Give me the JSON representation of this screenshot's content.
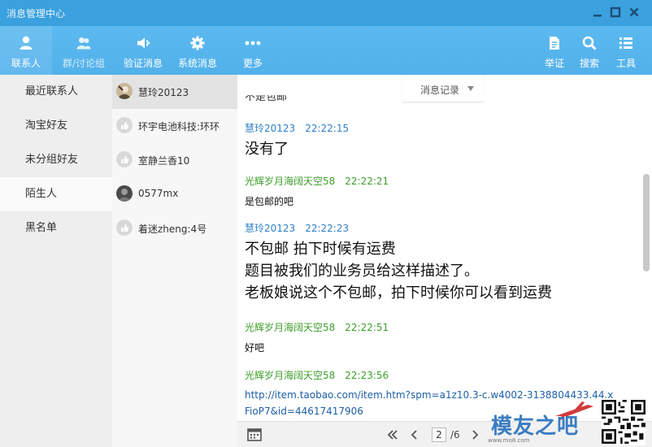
{
  "window": {
    "title": "消息管理中心"
  },
  "toolbar": {
    "left": [
      {
        "label": "联系人",
        "icon": "person-icon"
      },
      {
        "label": "群/讨论组",
        "icon": "group-icon"
      },
      {
        "label": "验证消息",
        "icon": "speaker-icon"
      },
      {
        "label": "系统消息",
        "icon": "gear-icon"
      },
      {
        "label": "更多",
        "icon": "more-icon"
      }
    ],
    "right": [
      {
        "label": "举证",
        "icon": "document-icon"
      },
      {
        "label": "搜索",
        "icon": "search-icon"
      },
      {
        "label": "工具",
        "icon": "list-icon"
      }
    ]
  },
  "nav": {
    "items": [
      {
        "label": "最近联系人"
      },
      {
        "label": "淘宝好友"
      },
      {
        "label": "未分组好友"
      },
      {
        "label": "陌生人"
      },
      {
        "label": "黑名单"
      }
    ],
    "selected": "陌生人"
  },
  "contacts": [
    {
      "name": "慧玲20123"
    },
    {
      "name": "环宇电池科技:环环"
    },
    {
      "name": "室静兰香10"
    },
    {
      "name": "0577mx"
    },
    {
      "name": "着迷zheng:4号"
    }
  ],
  "chat": {
    "record_dropdown": "消息记录",
    "cut_off_text": "不是包邮",
    "messages": [
      {
        "sender": "慧玲20123",
        "time": "22:22:15",
        "lines": [
          "没有了"
        ]
      },
      {
        "sender": "光辉岁月海阔天空58",
        "time": "22:22:21",
        "lines": [
          "是包邮的吧"
        ]
      },
      {
        "sender": "慧玲20123",
        "time": "22:22:23",
        "lines": [
          "不包邮 拍下时候有运费",
          "题目被我们的业务员给这样描述了。",
          "老板娘说这个不包邮，拍下时候你可以看到运费"
        ]
      },
      {
        "sender": "光辉岁月海阔天空58",
        "time": "22:22:51",
        "lines": [
          "好吧"
        ]
      },
      {
        "sender": "光辉岁月海阔天空58",
        "time": "22:23:56",
        "link": "http://item.taobao.com/item.htm?spm=a1z10.3-c.w4002-3138804433.44.xFioP7&id=44617417906"
      }
    ]
  },
  "pagination": {
    "current": "2",
    "total": "/6"
  },
  "watermark": {
    "text": "模友之吧",
    "url": "www.mo8.com"
  },
  "colors": {
    "titlebar": "#3aa0de",
    "toolbar": "#57b5ee",
    "blue_sender": "#2f7fc6",
    "green_sender": "#3d9e2a",
    "link": "#1d5fa6"
  }
}
